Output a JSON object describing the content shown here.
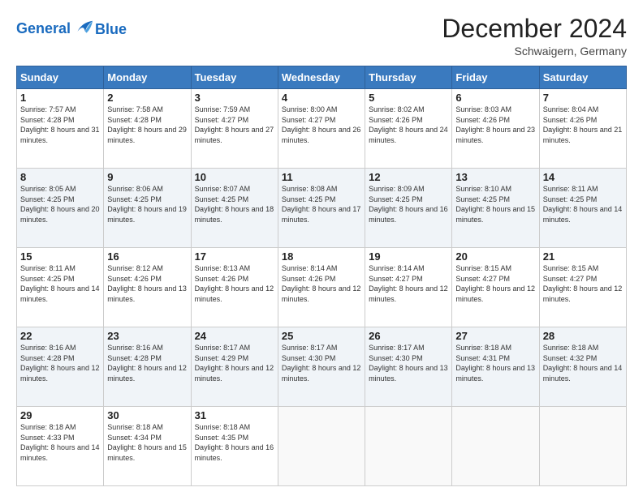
{
  "header": {
    "logo_line1": "General",
    "logo_line2": "Blue",
    "month": "December 2024",
    "location": "Schwaigern, Germany"
  },
  "weekdays": [
    "Sunday",
    "Monday",
    "Tuesday",
    "Wednesday",
    "Thursday",
    "Friday",
    "Saturday"
  ],
  "weeks": [
    [
      {
        "day": "1",
        "sunrise": "Sunrise: 7:57 AM",
        "sunset": "Sunset: 4:28 PM",
        "daylight": "Daylight: 8 hours and 31 minutes."
      },
      {
        "day": "2",
        "sunrise": "Sunrise: 7:58 AM",
        "sunset": "Sunset: 4:28 PM",
        "daylight": "Daylight: 8 hours and 29 minutes."
      },
      {
        "day": "3",
        "sunrise": "Sunrise: 7:59 AM",
        "sunset": "Sunset: 4:27 PM",
        "daylight": "Daylight: 8 hours and 27 minutes."
      },
      {
        "day": "4",
        "sunrise": "Sunrise: 8:00 AM",
        "sunset": "Sunset: 4:27 PM",
        "daylight": "Daylight: 8 hours and 26 minutes."
      },
      {
        "day": "5",
        "sunrise": "Sunrise: 8:02 AM",
        "sunset": "Sunset: 4:26 PM",
        "daylight": "Daylight: 8 hours and 24 minutes."
      },
      {
        "day": "6",
        "sunrise": "Sunrise: 8:03 AM",
        "sunset": "Sunset: 4:26 PM",
        "daylight": "Daylight: 8 hours and 23 minutes."
      },
      {
        "day": "7",
        "sunrise": "Sunrise: 8:04 AM",
        "sunset": "Sunset: 4:26 PM",
        "daylight": "Daylight: 8 hours and 21 minutes."
      }
    ],
    [
      {
        "day": "8",
        "sunrise": "Sunrise: 8:05 AM",
        "sunset": "Sunset: 4:25 PM",
        "daylight": "Daylight: 8 hours and 20 minutes."
      },
      {
        "day": "9",
        "sunrise": "Sunrise: 8:06 AM",
        "sunset": "Sunset: 4:25 PM",
        "daylight": "Daylight: 8 hours and 19 minutes."
      },
      {
        "day": "10",
        "sunrise": "Sunrise: 8:07 AM",
        "sunset": "Sunset: 4:25 PM",
        "daylight": "Daylight: 8 hours and 18 minutes."
      },
      {
        "day": "11",
        "sunrise": "Sunrise: 8:08 AM",
        "sunset": "Sunset: 4:25 PM",
        "daylight": "Daylight: 8 hours and 17 minutes."
      },
      {
        "day": "12",
        "sunrise": "Sunrise: 8:09 AM",
        "sunset": "Sunset: 4:25 PM",
        "daylight": "Daylight: 8 hours and 16 minutes."
      },
      {
        "day": "13",
        "sunrise": "Sunrise: 8:10 AM",
        "sunset": "Sunset: 4:25 PM",
        "daylight": "Daylight: 8 hours and 15 minutes."
      },
      {
        "day": "14",
        "sunrise": "Sunrise: 8:11 AM",
        "sunset": "Sunset: 4:25 PM",
        "daylight": "Daylight: 8 hours and 14 minutes."
      }
    ],
    [
      {
        "day": "15",
        "sunrise": "Sunrise: 8:11 AM",
        "sunset": "Sunset: 4:25 PM",
        "daylight": "Daylight: 8 hours and 14 minutes."
      },
      {
        "day": "16",
        "sunrise": "Sunrise: 8:12 AM",
        "sunset": "Sunset: 4:26 PM",
        "daylight": "Daylight: 8 hours and 13 minutes."
      },
      {
        "day": "17",
        "sunrise": "Sunrise: 8:13 AM",
        "sunset": "Sunset: 4:26 PM",
        "daylight": "Daylight: 8 hours and 12 minutes."
      },
      {
        "day": "18",
        "sunrise": "Sunrise: 8:14 AM",
        "sunset": "Sunset: 4:26 PM",
        "daylight": "Daylight: 8 hours and 12 minutes."
      },
      {
        "day": "19",
        "sunrise": "Sunrise: 8:14 AM",
        "sunset": "Sunset: 4:27 PM",
        "daylight": "Daylight: 8 hours and 12 minutes."
      },
      {
        "day": "20",
        "sunrise": "Sunrise: 8:15 AM",
        "sunset": "Sunset: 4:27 PM",
        "daylight": "Daylight: 8 hours and 12 minutes."
      },
      {
        "day": "21",
        "sunrise": "Sunrise: 8:15 AM",
        "sunset": "Sunset: 4:27 PM",
        "daylight": "Daylight: 8 hours and 12 minutes."
      }
    ],
    [
      {
        "day": "22",
        "sunrise": "Sunrise: 8:16 AM",
        "sunset": "Sunset: 4:28 PM",
        "daylight": "Daylight: 8 hours and 12 minutes."
      },
      {
        "day": "23",
        "sunrise": "Sunrise: 8:16 AM",
        "sunset": "Sunset: 4:28 PM",
        "daylight": "Daylight: 8 hours and 12 minutes."
      },
      {
        "day": "24",
        "sunrise": "Sunrise: 8:17 AM",
        "sunset": "Sunset: 4:29 PM",
        "daylight": "Daylight: 8 hours and 12 minutes."
      },
      {
        "day": "25",
        "sunrise": "Sunrise: 8:17 AM",
        "sunset": "Sunset: 4:30 PM",
        "daylight": "Daylight: 8 hours and 12 minutes."
      },
      {
        "day": "26",
        "sunrise": "Sunrise: 8:17 AM",
        "sunset": "Sunset: 4:30 PM",
        "daylight": "Daylight: 8 hours and 13 minutes."
      },
      {
        "day": "27",
        "sunrise": "Sunrise: 8:18 AM",
        "sunset": "Sunset: 4:31 PM",
        "daylight": "Daylight: 8 hours and 13 minutes."
      },
      {
        "day": "28",
        "sunrise": "Sunrise: 8:18 AM",
        "sunset": "Sunset: 4:32 PM",
        "daylight": "Daylight: 8 hours and 14 minutes."
      }
    ],
    [
      {
        "day": "29",
        "sunrise": "Sunrise: 8:18 AM",
        "sunset": "Sunset: 4:33 PM",
        "daylight": "Daylight: 8 hours and 14 minutes."
      },
      {
        "day": "30",
        "sunrise": "Sunrise: 8:18 AM",
        "sunset": "Sunset: 4:34 PM",
        "daylight": "Daylight: 8 hours and 15 minutes."
      },
      {
        "day": "31",
        "sunrise": "Sunrise: 8:18 AM",
        "sunset": "Sunset: 4:35 PM",
        "daylight": "Daylight: 8 hours and 16 minutes."
      },
      null,
      null,
      null,
      null
    ]
  ]
}
